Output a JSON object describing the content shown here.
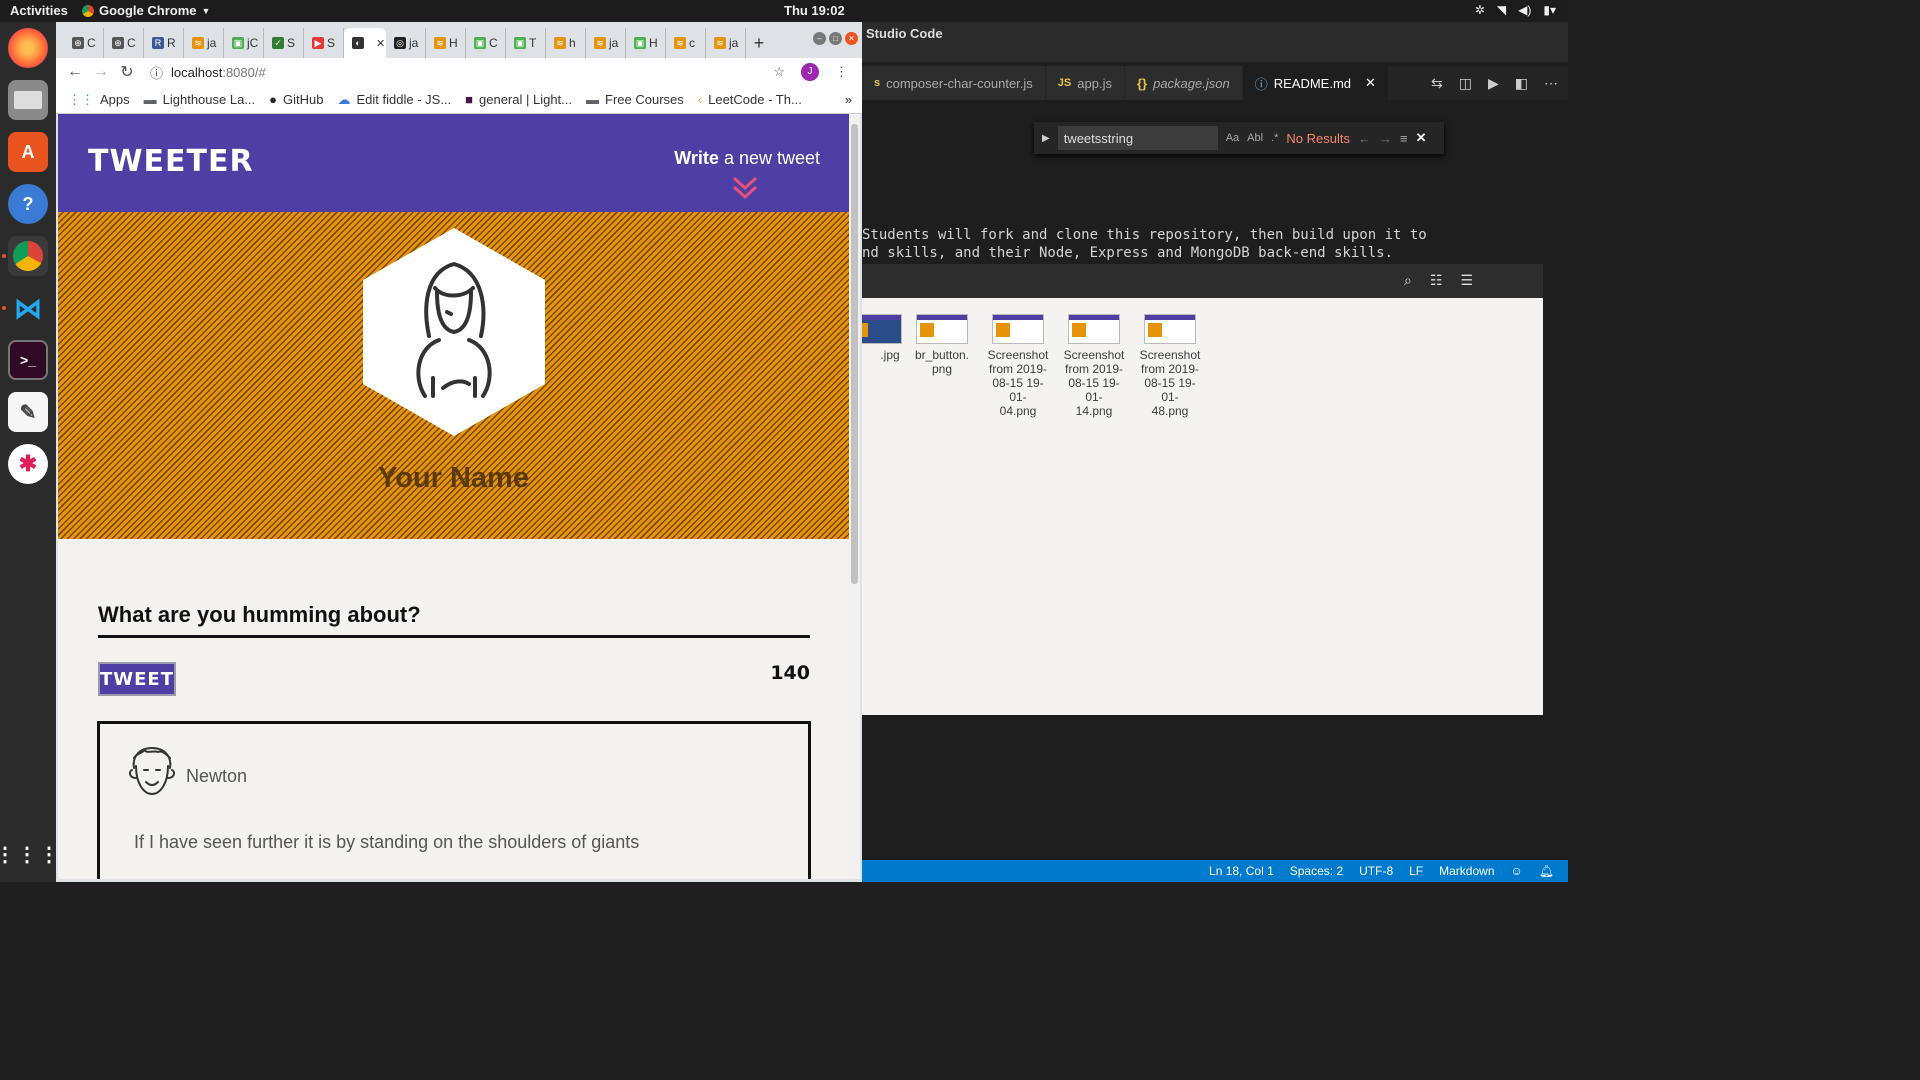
{
  "topbar": {
    "activities": "Activities",
    "app_name": "Google Chrome",
    "clock": "Thu 19:02"
  },
  "chrome": {
    "tabs": [
      {
        "label": "C",
        "fav_color": "#555555",
        "fav": "⊕"
      },
      {
        "label": "C",
        "fav_color": "#555555",
        "fav": "⊕"
      },
      {
        "label": "R",
        "fav_color": "#3b5998",
        "fav": "R"
      },
      {
        "label": "ja",
        "fav_color": "#e6930c",
        "fav": "≋"
      },
      {
        "label": "jC",
        "fav_color": "#4caf50",
        "fav": "▣"
      },
      {
        "label": "S",
        "fav_color": "#2e7d32",
        "fav": "✓"
      },
      {
        "label": "S",
        "fav_color": "#e53935",
        "fav": "▶"
      },
      {
        "label": "",
        "fav_color": "#333333",
        "fav": "◐"
      },
      {
        "label": "ja",
        "fav_color": "#222222",
        "fav": "◎"
      },
      {
        "label": "H",
        "fav_color": "#e6930c",
        "fav": "≋"
      },
      {
        "label": "C",
        "fav_color": "#4caf50",
        "fav": "▣"
      },
      {
        "label": "T",
        "fav_color": "#4caf50",
        "fav": "▣"
      },
      {
        "label": "h",
        "fav_color": "#e6930c",
        "fav": "≋"
      },
      {
        "label": "ja",
        "fav_color": "#e6930c",
        "fav": "≋"
      },
      {
        "label": "H",
        "fav_color": "#4caf50",
        "fav": "▣"
      },
      {
        "label": "c",
        "fav_color": "#e6930c",
        "fav": "≋"
      },
      {
        "label": "ja",
        "fav_color": "#e6930c",
        "fav": "≋"
      }
    ],
    "url_host": "localhost",
    "url_path": ":8080/#",
    "profile_initial": "J",
    "bookmarks": [
      {
        "label": "Apps",
        "icon": "apps-grid-icon"
      },
      {
        "label": "Lighthouse La...",
        "icon": "folder-icon"
      },
      {
        "label": "GitHub",
        "icon": "github-icon"
      },
      {
        "label": "Edit fiddle - JS...",
        "icon": "cloud-icon"
      },
      {
        "label": "general | Light...",
        "icon": "slack-icon"
      },
      {
        "label": "Free Courses",
        "icon": "folder-icon"
      },
      {
        "label": "LeetCode - Th...",
        "icon": "leetcode-icon"
      }
    ]
  },
  "page": {
    "logo": "TWEETER",
    "write_bold": "Write",
    "write_rest": "a new tweet",
    "profile_name": "Your Name",
    "composer_prompt": "What are you humming about?",
    "tweet_button": "TWEET",
    "counter": "140",
    "tweet": {
      "user": "Newton",
      "text": "If I have seen further it is by standing on the shoulders of giants"
    },
    "colors": {
      "brand_purple": "#4f3ea4",
      "header_orange": "#e6930c",
      "chevron_pink": "#e8507a"
    }
  },
  "vscode": {
    "title": "Studio Code",
    "tabs": [
      {
        "label": "composer-char-counter.js",
        "kind": "s",
        "active": false
      },
      {
        "label": "app.js",
        "kind": "JS",
        "active": false
      },
      {
        "label": "package.json",
        "kind": "{}",
        "active": false
      },
      {
        "label": "README.md",
        "kind": "i",
        "active": true
      }
    ],
    "find_query": "tweetsstring",
    "find_result": "No Results",
    "find_opt_case": "Aa",
    "find_opt_word": "Abl",
    "find_opt_regex": ".*",
    "editor_line1": "Students will fork and clone this repository, then build upon it to",
    "editor_line2": "nd skills, and their Node, Express and MongoDB back-end skills.",
    "status": {
      "position": "Ln 18, Col 1",
      "spaces": "Spaces: 2",
      "encoding": "UTF-8",
      "eol": "LF",
      "language": "Markdown"
    }
  },
  "files": {
    "items": [
      {
        "name": ".jpg"
      },
      {
        "name": "br_button.\npng"
      },
      {
        "name": "Screenshot\nfrom 2019-\n08-15 19-01-\n04.png"
      },
      {
        "name": "Screenshot\nfrom 2019-\n08-15 19-01-\n14.png"
      },
      {
        "name": "Screenshot\nfrom 2019-\n08-15 19-01-\n48.png"
      }
    ]
  }
}
